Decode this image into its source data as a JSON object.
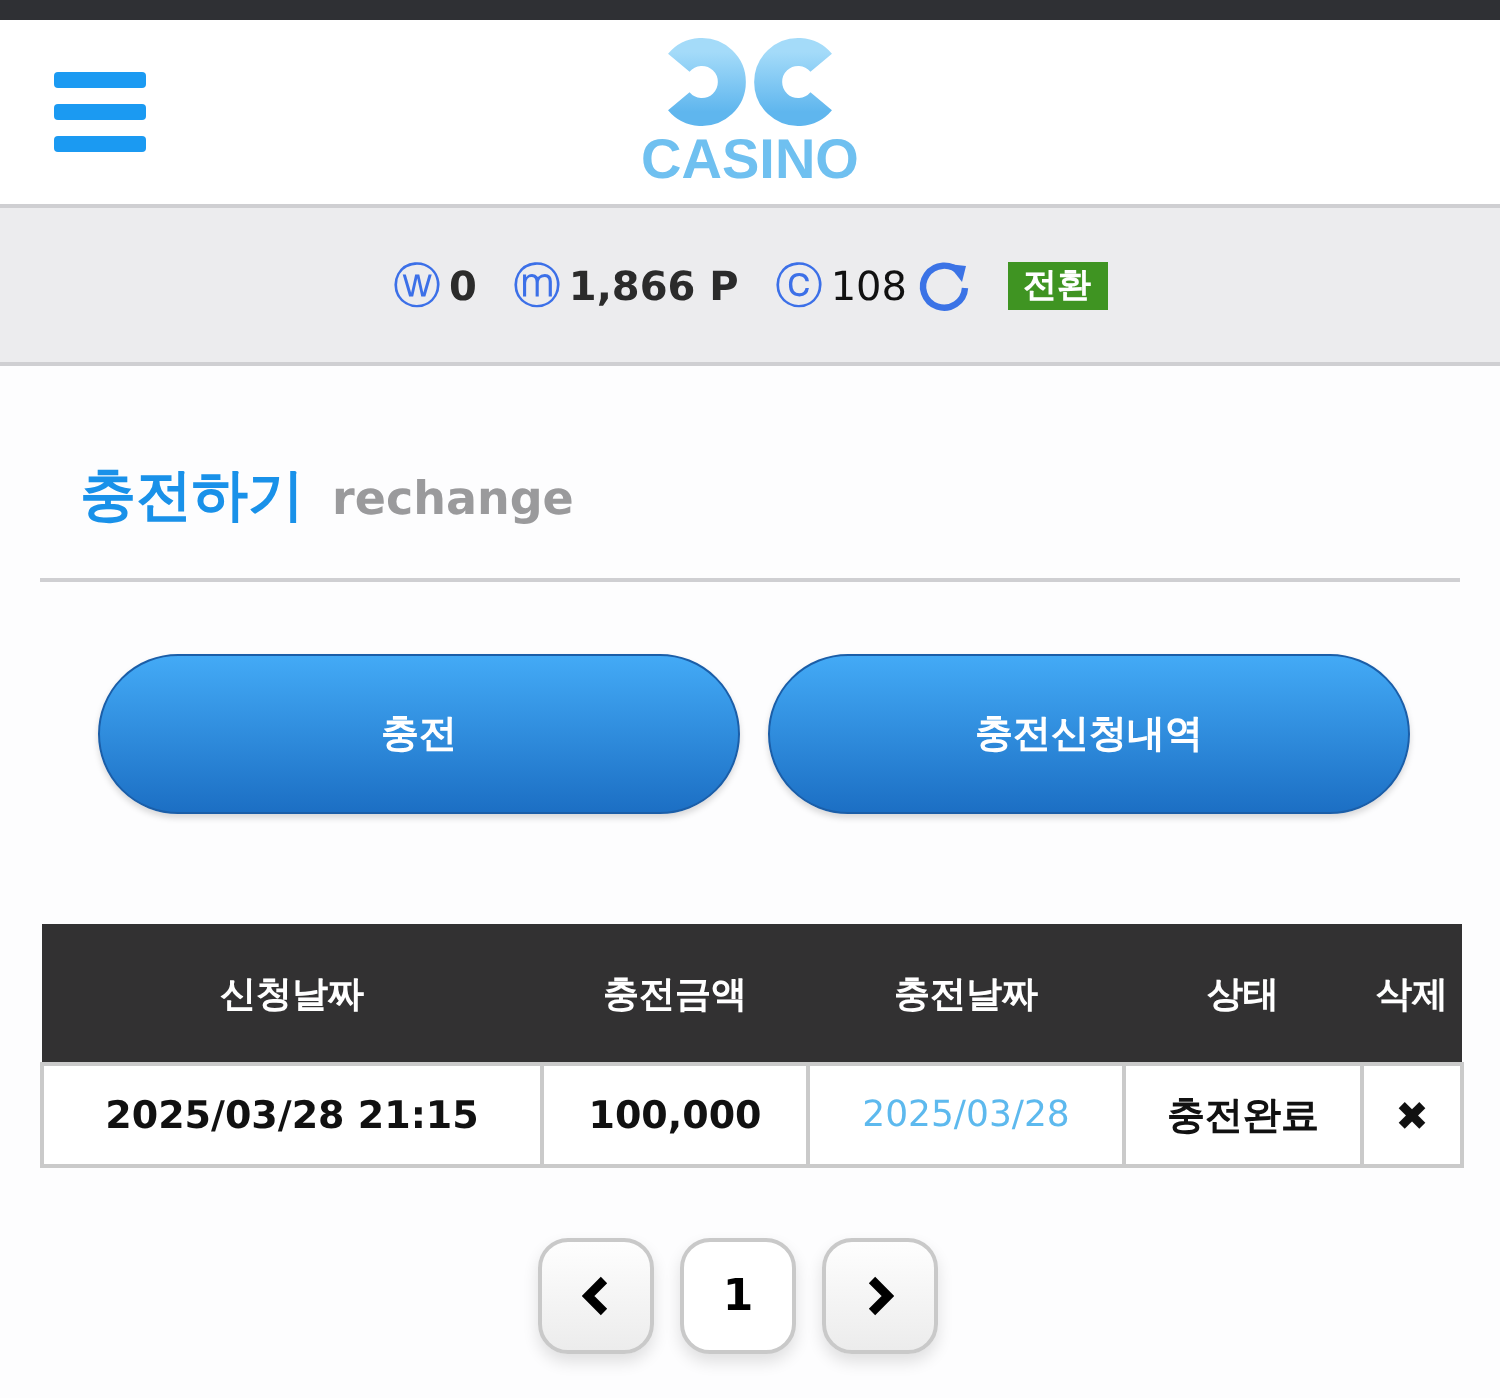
{
  "header": {
    "logo_text": "CASINO"
  },
  "balance": {
    "items": [
      {
        "symbol": "ⓦ",
        "value": "0"
      },
      {
        "symbol": "ⓜ",
        "value": "1,866 P"
      },
      {
        "symbol": "ⓒ",
        "value": "108"
      }
    ],
    "convert_button": "전환"
  },
  "page_title": {
    "title": "충전하기",
    "subtitle": "rechange"
  },
  "action_buttons": [
    "충전",
    "충전신청내역"
  ],
  "table": {
    "columns": [
      "신청날짜",
      "충전금액",
      "충전날짜",
      "상태",
      "삭제"
    ],
    "rows": [
      {
        "cells": [
          {
            "kind": "text",
            "text": "2025/03/28 21:15"
          },
          {
            "kind": "text",
            "text": "100,000"
          },
          {
            "kind": "link",
            "text": "2025/03/28"
          },
          {
            "kind": "text",
            "text": "충전완료"
          },
          {
            "kind": "delete",
            "text": "✖"
          }
        ]
      }
    ]
  },
  "pagination": {
    "pages": [
      "1"
    ]
  }
}
